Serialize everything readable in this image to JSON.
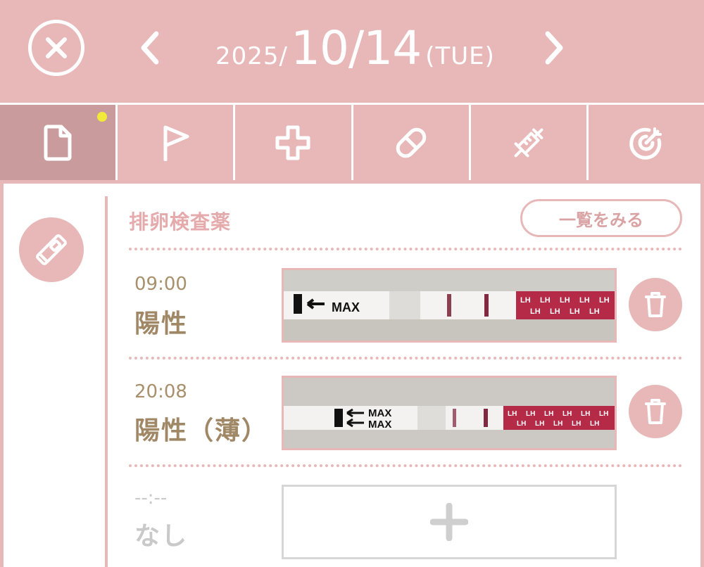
{
  "header": {
    "year": "2025/",
    "month_day": "10/14",
    "weekday": "(TUE)"
  },
  "tabs": [
    {
      "icon": "document-icon",
      "active": true,
      "has_dot": true
    },
    {
      "icon": "flag-icon",
      "active": false
    },
    {
      "icon": "plus-cross-icon",
      "active": false
    },
    {
      "icon": "pill-icon",
      "active": false
    },
    {
      "icon": "syringe-icon",
      "active": false
    },
    {
      "icon": "target-icon",
      "active": false
    }
  ],
  "section": {
    "title": "排卵検査薬",
    "list_button": "一覧をみる"
  },
  "entries": [
    {
      "time": "09:00",
      "result": "陽性"
    },
    {
      "time": "20:08",
      "result": "陽性（薄）"
    }
  ],
  "empty_entry": {
    "time": "--:--",
    "result": "なし"
  },
  "strip": {
    "max_label": "MAX",
    "lh_label": "LH"
  },
  "colors": {
    "accent": "#e8b8b9",
    "active_tab": "#c99b9c",
    "text_brown": "#a08866",
    "dot": "#f2ea3a",
    "strip_band": "#b52a47"
  }
}
